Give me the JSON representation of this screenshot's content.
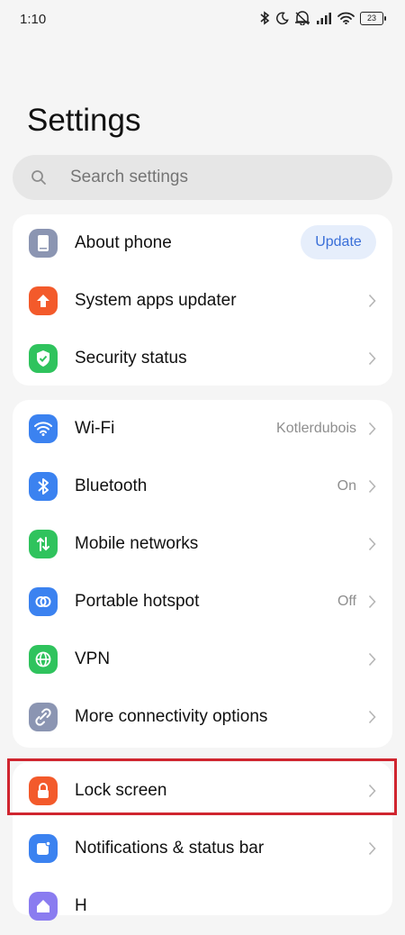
{
  "status": {
    "time": "1:10",
    "battery": "23"
  },
  "title": "Settings",
  "search": {
    "placeholder": "Search settings"
  },
  "groups": [
    {
      "items": [
        {
          "label": "About phone",
          "action": "Update",
          "icon": "phone-icon",
          "color": "#8b95b2"
        },
        {
          "label": "System apps updater",
          "icon": "arrow-up-icon",
          "color": "#f35a2b"
        },
        {
          "label": "Security status",
          "icon": "shield-check-icon",
          "color": "#2fc35d"
        }
      ]
    },
    {
      "items": [
        {
          "label": "Wi-Fi",
          "value": "Kotlerdubois",
          "icon": "wifi-icon",
          "color": "#3b82f0"
        },
        {
          "label": "Bluetooth",
          "value": "On",
          "icon": "bluetooth-icon",
          "color": "#3b82f0"
        },
        {
          "label": "Mobile networks",
          "icon": "mobile-data-icon",
          "color": "#2fc35d"
        },
        {
          "label": "Portable hotspot",
          "value": "Off",
          "icon": "hotspot-icon",
          "color": "#3b82f0"
        },
        {
          "label": "VPN",
          "icon": "globe-icon",
          "color": "#2fc35d"
        },
        {
          "label": "More connectivity options",
          "icon": "link-icon",
          "color": "#8b95b2"
        }
      ]
    },
    {
      "items": [
        {
          "label": "Lock screen",
          "icon": "lock-icon",
          "color": "#f35a2b"
        },
        {
          "label": "Notifications & status bar",
          "icon": "notification-icon",
          "color": "#3b82f0"
        },
        {
          "label": "H",
          "icon": "home-screen-icon",
          "color": "#8a7cf0"
        }
      ]
    }
  ]
}
